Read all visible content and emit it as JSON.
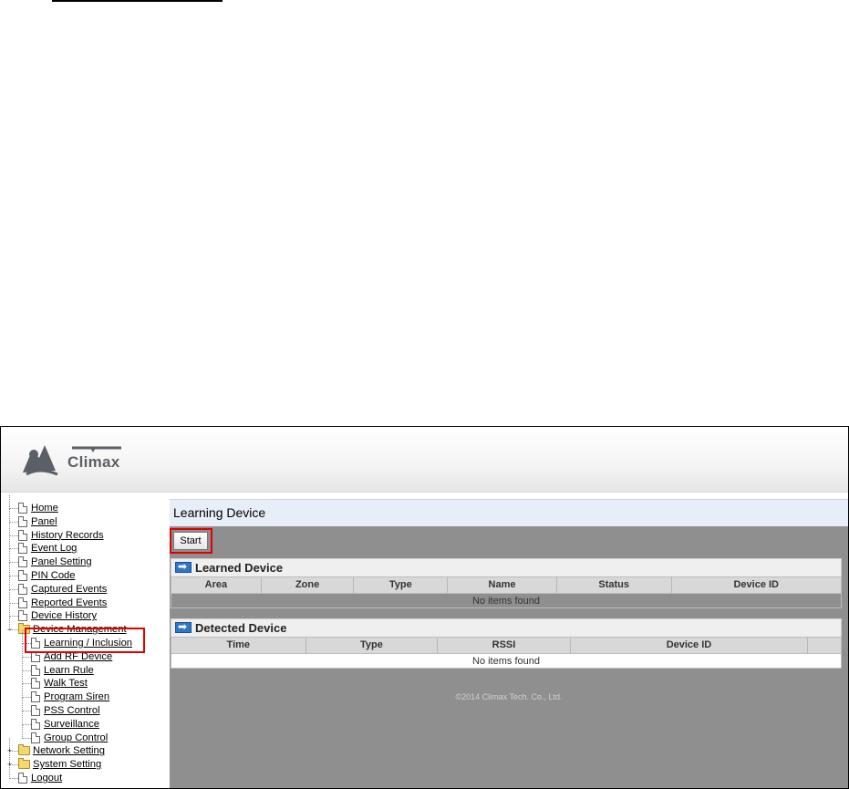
{
  "app": {
    "logo_text": "Climax",
    "brand_color": "#5b5f66",
    "highlight_color": "#e00000"
  },
  "sidebar": {
    "items": [
      {
        "label": "Home",
        "icon": "document-icon",
        "level": 0
      },
      {
        "label": "Panel",
        "icon": "document-icon",
        "level": 0
      },
      {
        "label": "History Records",
        "icon": "document-icon",
        "level": 0
      },
      {
        "label": "Event Log",
        "icon": "document-icon",
        "level": 0
      },
      {
        "label": "Panel Setting",
        "icon": "document-icon",
        "level": 0
      },
      {
        "label": "PIN Code",
        "icon": "document-icon",
        "level": 0
      },
      {
        "label": "Captured Events",
        "icon": "document-icon",
        "level": 0
      },
      {
        "label": "Reported Events",
        "icon": "document-icon",
        "level": 0
      },
      {
        "label": "Device History",
        "icon": "document-icon",
        "level": 0
      },
      {
        "label": "Device Management",
        "icon": "folder-open-icon",
        "level": 0,
        "expanded": true
      },
      {
        "label": "Learning / Inclusion",
        "icon": "document-icon",
        "level": 1,
        "selected": true
      },
      {
        "label": "Add RF Device",
        "icon": "document-icon",
        "level": 1
      },
      {
        "label": "Learn Rule",
        "icon": "document-icon",
        "level": 1
      },
      {
        "label": "Walk Test",
        "icon": "document-icon",
        "level": 1
      },
      {
        "label": "Program Siren",
        "icon": "document-icon",
        "level": 1
      },
      {
        "label": "PSS Control",
        "icon": "document-icon",
        "level": 1
      },
      {
        "label": "Surveillance",
        "icon": "document-icon",
        "level": 1
      },
      {
        "label": "Group Control",
        "icon": "document-icon",
        "level": 1
      },
      {
        "label": "Network Setting",
        "icon": "folder-icon",
        "level": 0,
        "expanded": false
      },
      {
        "label": "System Setting",
        "icon": "folder-icon",
        "level": 0,
        "expanded": false
      },
      {
        "label": "Logout",
        "icon": "document-icon",
        "level": 0
      }
    ]
  },
  "main": {
    "page_title": "Learning Device",
    "start_label": "Start",
    "learned": {
      "title": "Learned Device",
      "columns": [
        "Area",
        "Zone",
        "Type",
        "Name",
        "Status",
        "Device ID"
      ],
      "empty_text": "No items found"
    },
    "detected": {
      "title": "Detected Device",
      "columns": [
        "Time",
        "Type",
        "RSSI",
        "Device ID",
        ""
      ],
      "empty_text": "No items found"
    },
    "footer": "©2014 Climax Tech. Co., Ltd."
  }
}
